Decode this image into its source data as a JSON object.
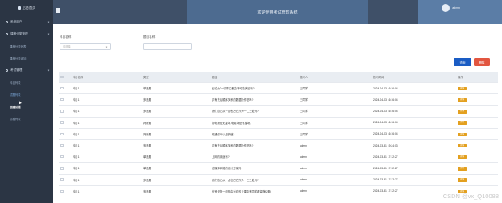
{
  "sidebar": {
    "brand": "后台首页",
    "items": [
      {
        "label": "系统用户"
      },
      {
        "label": "课程分类管理",
        "children": [
          {
            "label": "课程分类列表"
          },
          {
            "label": "课程分类添加"
          }
        ]
      },
      {
        "label": "考试管理",
        "children": [
          {
            "label": "科目列表"
          },
          {
            "label": "试题列表"
          },
          {
            "label": "创建试题"
          },
          {
            "label": "试卷列表"
          }
        ]
      }
    ]
  },
  "header": {
    "title": "欢迎使用考试管理系统",
    "user": "admin"
  },
  "search": {
    "subject_label": "科目名称",
    "subject_placeholder": "请选择",
    "title_label": "题目名称",
    "title_placeholder": ""
  },
  "buttons": {
    "search": "查询",
    "delete": "删除"
  },
  "table": {
    "headers": [
      "科目名称",
      "类型",
      "题目",
      "提问人",
      "提问时间",
      "操作"
    ],
    "op_label": "详情",
    "rows": [
      [
        "科目1",
        "单选题",
        "结论为\"一切事实都由不可能满足吗?",
        "王同学",
        "2024-04-03 16:16:04"
      ],
      [
        "科目1",
        "多选题",
        "具有先后顺序关系的数据操作是吗?",
        "王同学",
        "2024-04-03 16:16:04"
      ],
      [
        "科目1",
        "多选题",
        "我们自己从一点也把它作为一二三处吗?",
        "王同学",
        "2024-04-03 16:16:04"
      ],
      [
        "科目1",
        "判断题",
        "静电场是无旋场,电磁场是有旋场,",
        "王同学",
        "2024-04-03 16:16:04"
      ],
      [
        "科目1",
        "判断题",
        "磁通量可以是负值?",
        "王同学",
        "2024-04-03 16:16:04"
      ],
      [
        "科目1",
        "多选题",
        "具有先后顺序关系的数据操作是吗?",
        "admin",
        "2024-03-31 19:24:03"
      ],
      [
        "科目1",
        "单选题",
        "上网的用途有?",
        "admin",
        "2024-03-31 17:12:27"
      ],
      [
        "科目1",
        "单选题",
        "自媒体网络的设计方案吗",
        "admin",
        "2024-03-31 17:12:27"
      ],
      [
        "科目1",
        "多选题",
        "我们自己从一点也把它作为一二三处吗?",
        "admin",
        "2024-03-31 17:12:27"
      ],
      [
        "科目1",
        "多选题",
        "信号是指一般是由对应的上课中有同学希望(第2期)",
        "admin",
        "2024-03-31 17:12:27"
      ]
    ]
  },
  "watermark": "CSDN @vx_Q10088"
}
